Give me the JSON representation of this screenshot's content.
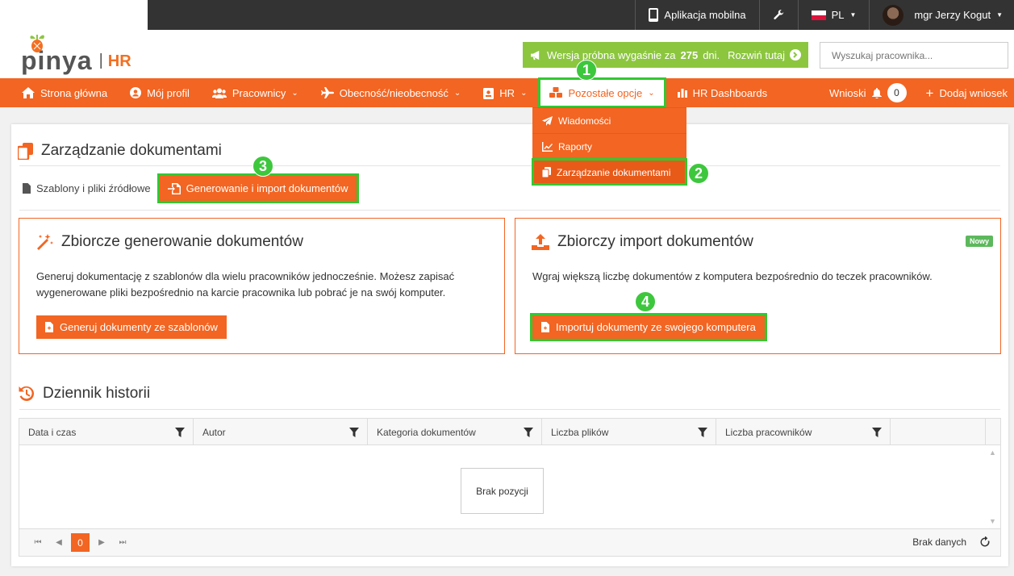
{
  "topbar": {
    "mobile_app": "Aplikacja mobilna",
    "language": "PL",
    "user_name": "mgr Jerzy Kogut"
  },
  "header": {
    "logo_word": "pinya",
    "logo_sep": "|",
    "logo_hr": "HR",
    "trial_prefix": "Wersja próbna wygaśnie za",
    "trial_days": "275",
    "trial_suffix": "dni.",
    "trial_link": "Rozwiń tutaj",
    "search_placeholder": "Wyszukaj pracownika..."
  },
  "nav": {
    "home": "Strona główna",
    "profile": "Mój profil",
    "employees": "Pracownicy",
    "attendance": "Obecność/nieobecność",
    "hr": "HR",
    "other": "Pozostałe opcje",
    "dashboards": "HR Dashboards",
    "requests": "Wnioski",
    "requests_count": "0",
    "add_request": "Dodaj wniosek"
  },
  "dropdown": {
    "items": [
      "Wiadomości",
      "Raporty",
      "Zarządzanie dokumentami"
    ]
  },
  "page": {
    "title": "Zarządzanie dokumentami",
    "tab_templates": "Szablony i pliki źródłowe",
    "tab_generate": "Generowanie i import dokumentów"
  },
  "card_generate": {
    "title": "Zbiorcze generowanie dokumentów",
    "description": "Generuj dokumentację z szablonów dla wielu pracowników jednocześnie. Możesz zapisać wygenerowane pliki bezpośrednio na karcie pracownika lub pobrać je na swój komputer.",
    "button": "Generuj dokumenty ze szablonów"
  },
  "card_import": {
    "title": "Zbiorczy import dokumentów",
    "badge": "Nowy",
    "description": "Wgraj większą liczbę dokumentów z komputera bezpośrednio do teczek pracowników.",
    "button": "Importuj dokumenty ze swojego komputera"
  },
  "history": {
    "title": "Dziennik historii",
    "columns": [
      "Data i czas",
      "Autor",
      "Kategoria dokumentów",
      "Liczba plików",
      "Liczba pracowników"
    ],
    "empty": "Brak pozycji",
    "current_page": "0",
    "no_data": "Brak danych"
  },
  "markers": [
    "1",
    "2",
    "3",
    "4"
  ],
  "colors": {
    "accent": "#f26522",
    "highlight": "#32c832",
    "trial": "#8cc63f"
  }
}
